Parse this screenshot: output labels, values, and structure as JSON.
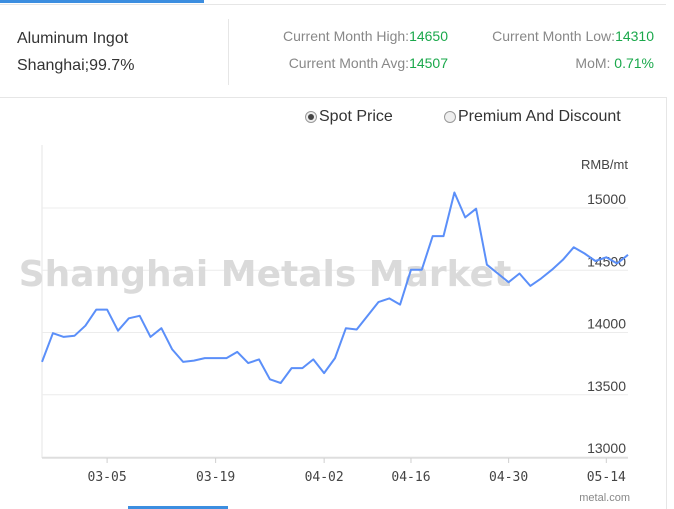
{
  "product": {
    "name": "Aluminum Ingot",
    "spec": "Shanghai;99.7%"
  },
  "stats": {
    "high_label": "Current Month High:",
    "high_value": "14650",
    "low_label": "Current Month Low:",
    "low_value": "14310",
    "avg_label": "Current Month Avg:",
    "avg_value": "14507",
    "mom_label": "MoM:",
    "mom_value": "0.71%"
  },
  "options": [
    {
      "label": "Spot Price",
      "checked": true
    },
    {
      "label": "Premium And Discount",
      "checked": false
    }
  ],
  "watermark": "Shanghai Metals Market",
  "source": "metal.com",
  "colors": {
    "line": "#5b8ff9",
    "accent": "#3c8ee0",
    "positive": "#1aa84b"
  },
  "chart_data": {
    "type": "line",
    "ylabel": "RMB/mt",
    "ylim": [
      13000,
      15000
    ],
    "yticks": [
      "15000",
      "14500",
      "14000",
      "13500",
      "13000"
    ],
    "ytick_values": [
      15000,
      14500,
      14000,
      13500,
      13000
    ],
    "xticks": [
      "03-05",
      "03-19",
      "04-02",
      "04-16",
      "04-30",
      "05-14"
    ],
    "xtick_index": [
      6,
      16,
      26,
      34,
      43,
      52
    ],
    "series": [
      {
        "values": [
          13700,
          13930,
          13900,
          13910,
          13990,
          14120,
          14120,
          13950,
          14050,
          14070,
          13900,
          13970,
          13800,
          13700,
          13710,
          13730,
          13730,
          13730,
          13780,
          13690,
          13720,
          13560,
          13530,
          13650,
          13650,
          13720,
          13610,
          13730,
          13970,
          13960,
          14070,
          14180,
          14210,
          14160,
          14440,
          14440,
          14710,
          14710,
          15060,
          14860,
          14930,
          14480,
          14410,
          14340,
          14410,
          14310,
          14370,
          14440,
          14520,
          14620,
          14570,
          14510,
          14540,
          14490,
          14560
        ]
      }
    ]
  }
}
